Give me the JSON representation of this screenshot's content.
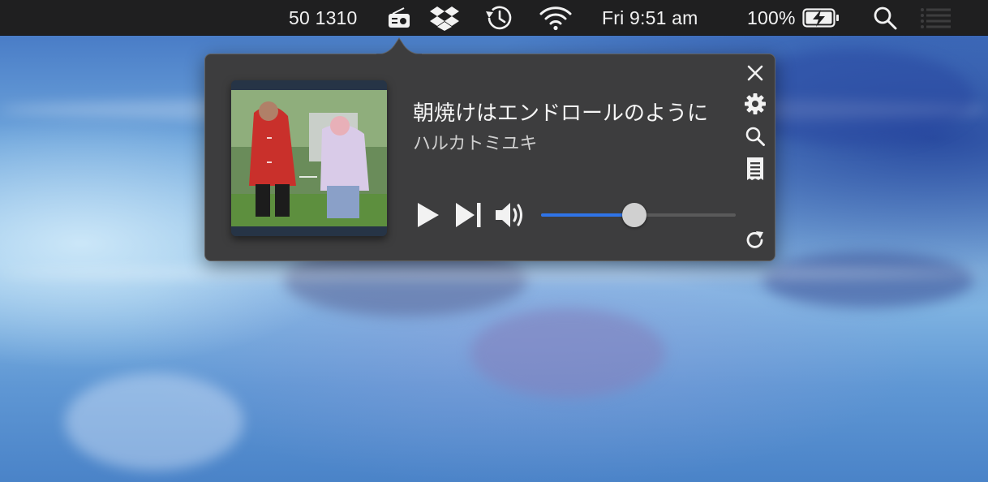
{
  "menubar": {
    "counter_text": "50 1310",
    "clock_text": "Fri 9:51 am",
    "battery_text": "100%",
    "icons": [
      "radio-icon",
      "dropbox-icon",
      "time-machine-icon",
      "wifi-icon",
      "battery-charging-icon",
      "spotlight-icon",
      "notification-center-icon"
    ]
  },
  "player": {
    "title": "朝焼けはエンドロールのように",
    "artist": "ハルカトミユキ",
    "volume_fraction": 0.48,
    "controls": [
      "play-icon",
      "next-track-icon",
      "volume-icon"
    ],
    "side_icons": [
      "close-icon",
      "gear-icon",
      "search-icon",
      "lyrics-icon",
      "refresh-icon"
    ]
  },
  "colors": {
    "menubar_bg": "#1f1f20",
    "popover_bg": "#3d3d3e",
    "slider_fill": "#2f74e8"
  }
}
